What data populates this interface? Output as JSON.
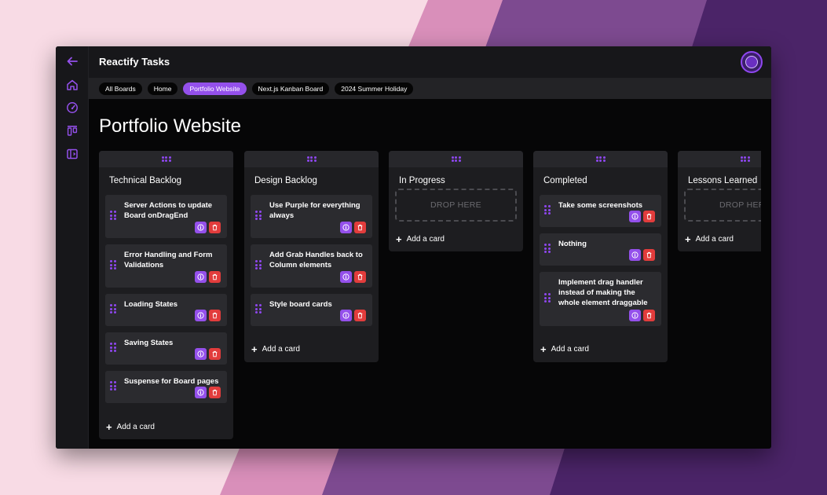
{
  "colors": {
    "accent": "#9450eb",
    "danger": "#e23c3c",
    "window_bg": "#060607",
    "panel_bg": "#1d1d20",
    "card_bg": "#2b2b2f"
  },
  "sidebar": {
    "items": [
      {
        "icon": "arrow-left-icon"
      },
      {
        "icon": "home-icon"
      },
      {
        "icon": "gauge-icon"
      },
      {
        "icon": "kanban-icon"
      },
      {
        "icon": "panel-icon"
      }
    ]
  },
  "header": {
    "title": "Reactify Tasks",
    "avatar_icon": "user-avatar"
  },
  "breadcrumbs": [
    {
      "label": "All Boards",
      "active": false
    },
    {
      "label": "Home",
      "active": false
    },
    {
      "label": "Portfolio Website",
      "active": true
    },
    {
      "label": "Next.js Kanban Board",
      "active": false
    },
    {
      "label": "2024 Summer Holiday",
      "active": false
    }
  ],
  "board": {
    "title": "Portfolio Website",
    "add_card_label": "Add a card",
    "drop_label": "DROP HERE",
    "columns": [
      {
        "title": "Technical Backlog",
        "cards": [
          "Server Actions to update Board onDragEnd",
          "Error Handling and Form Validations",
          "Loading States",
          "Saving States",
          "Suspense for Board pages"
        ]
      },
      {
        "title": "Design Backlog",
        "cards": [
          "Use Purple for everything always",
          "Add Grab Handles back to Column elements",
          "Style board cards"
        ]
      },
      {
        "title": "In Progress",
        "cards": []
      },
      {
        "title": "Completed",
        "cards": [
          "Take some screenshots",
          "Nothing",
          "Implement drag handler instead of making the whole element draggable"
        ]
      },
      {
        "title": "Lessons Learned",
        "cards": []
      }
    ]
  }
}
